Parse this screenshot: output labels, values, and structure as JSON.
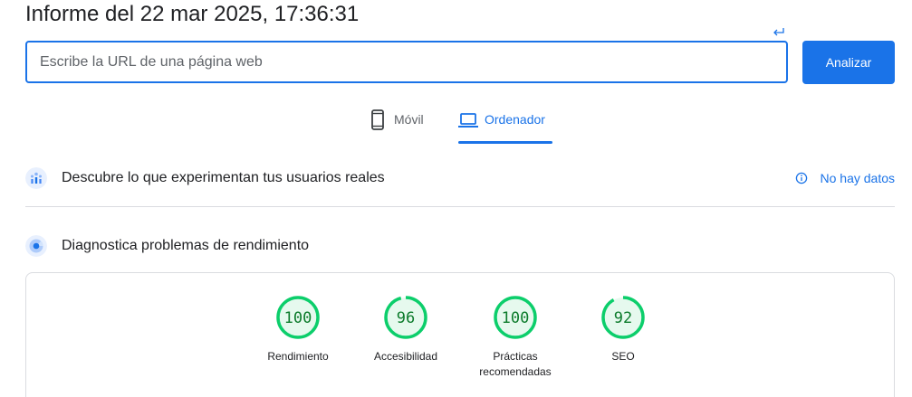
{
  "report": {
    "title": "Informe del 22 mar 2025, 17:36:31"
  },
  "url_form": {
    "placeholder": "Escribe la URL de una página web",
    "value": "",
    "analyze_label": "Analizar"
  },
  "device_tabs": [
    {
      "label": "Móvil",
      "icon": "smartphone-icon",
      "selected": false
    },
    {
      "label": "Ordenador",
      "icon": "laptop-icon",
      "selected": true
    }
  ],
  "real_users": {
    "title": "Descubre lo que experimentan tus usuarios reales",
    "icon": "crux-users-icon",
    "status_label": "No hay datos",
    "status_icon": "info-icon"
  },
  "diagnose": {
    "title": "Diagnostica problemas de rendimiento",
    "icon": "lighthouse-icon"
  },
  "scores": [
    {
      "name": "Rendimiento",
      "value": "100"
    },
    {
      "name": "Accesibilidad",
      "value": "96"
    },
    {
      "name": "Prácticas recomendadas",
      "value": "100"
    },
    {
      "name": "SEO",
      "value": "92"
    }
  ],
  "colors": {
    "accent": "#1a73e8",
    "pass_ring": "#0cce6b",
    "pass_fill": "#e6f9ee",
    "pass_text": "#0c7b2b",
    "divider": "#dadce0"
  }
}
